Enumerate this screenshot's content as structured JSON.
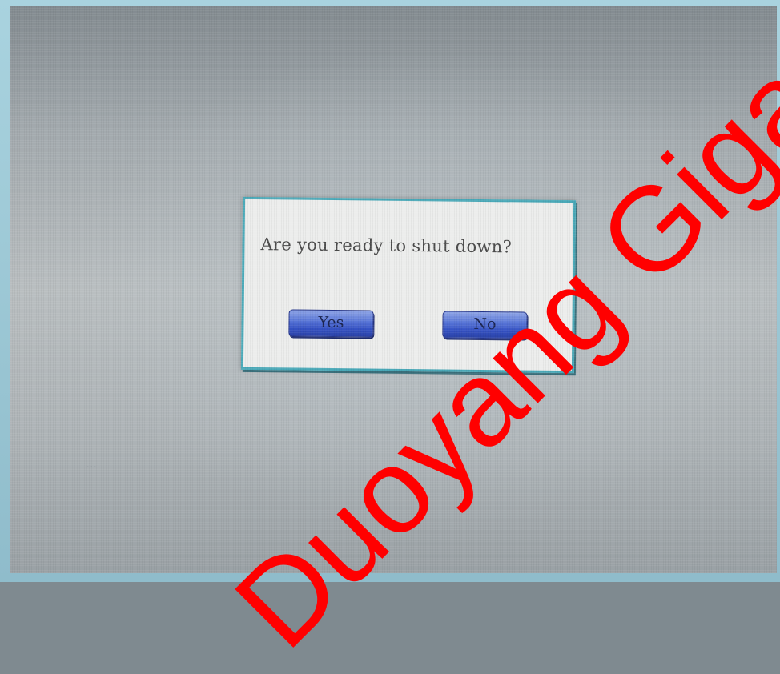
{
  "dialog": {
    "message": "Are you ready to shut down?",
    "yes_label": "Yes",
    "no_label": "No"
  },
  "background": {
    "faint_label": "..."
  },
  "watermark": {
    "text": "Duoyang Giga"
  },
  "colors": {
    "dialog_border": "#4aa9b8",
    "button_blue": "#3552c4",
    "watermark": "#ff0000"
  }
}
